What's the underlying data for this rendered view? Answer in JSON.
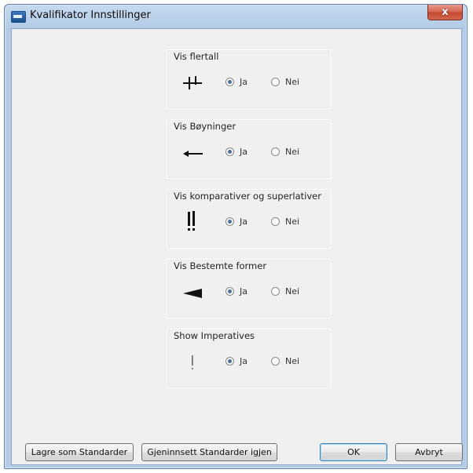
{
  "window": {
    "title": "Kvalifikator Innstillinger",
    "close_label": "x",
    "app_icon": "app-icon"
  },
  "groups": [
    {
      "label": "Vis flertall",
      "glyph": "++",
      "glyph_icon": "plural-marker-icon",
      "option_yes": "Ja",
      "option_no": "Nei",
      "selected": "Ja"
    },
    {
      "label": "Vis Bøyninger",
      "glyph": "←",
      "glyph_icon": "arrow-left-icon",
      "option_yes": "Ja",
      "option_no": "Nei",
      "selected": "Ja"
    },
    {
      "label": "Vis komparativer og superlativer",
      "glyph": "!!",
      "glyph_icon": "double-exclamation-icon",
      "option_yes": "Ja",
      "option_no": "Nei",
      "selected": "Ja"
    },
    {
      "label": "Vis Bestemte former",
      "glyph": "◄",
      "glyph_icon": "wedge-left-icon",
      "option_yes": "Ja",
      "option_no": "Nei",
      "selected": "Ja"
    },
    {
      "label": "Show Imperatives",
      "glyph": "!",
      "glyph_icon": "exclamation-icon",
      "option_yes": "Ja",
      "option_no": "Nei",
      "selected": "Ja"
    }
  ],
  "buttons": {
    "save_defaults": "Lagre som Standarder",
    "restore_defaults": "Gjeninnsett Standarder igjen",
    "ok": "OK",
    "cancel": "Avbryt"
  }
}
